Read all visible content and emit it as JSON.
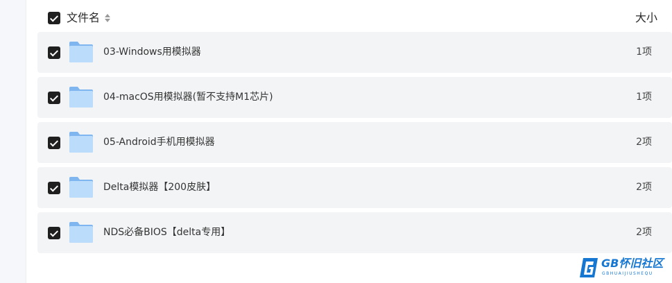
{
  "header": {
    "name_label": "文件名",
    "size_label": "大小",
    "sort_icon": "sort-updown-icon",
    "select_all_checked": true
  },
  "files": [
    {
      "name": "03-Windows用模拟器",
      "size": "1项",
      "checked": true,
      "icon": "folder-icon"
    },
    {
      "name": "04-macOS用模拟器(暂不支持M1芯片)",
      "size": "1项",
      "checked": true,
      "icon": "folder-icon"
    },
    {
      "name": "05-Android手机用模拟器",
      "size": "2项",
      "checked": true,
      "icon": "folder-icon"
    },
    {
      "name": "Delta模拟器【200皮肤】",
      "size": "2项",
      "checked": true,
      "icon": "folder-icon"
    },
    {
      "name": "NDS必备BIOS【delta专用】",
      "size": "2项",
      "checked": true,
      "icon": "folder-icon"
    }
  ],
  "watermark": {
    "title": "GB怀旧社区",
    "subtitle": "GBHUAIJIUSHEQU"
  },
  "colors": {
    "row_bg": "#f3f4f6",
    "checkbox": "#1f1f1f",
    "folder_light": "#bcdcfb",
    "folder_dark": "#7fb6f0",
    "watermark": "#1677d2"
  }
}
